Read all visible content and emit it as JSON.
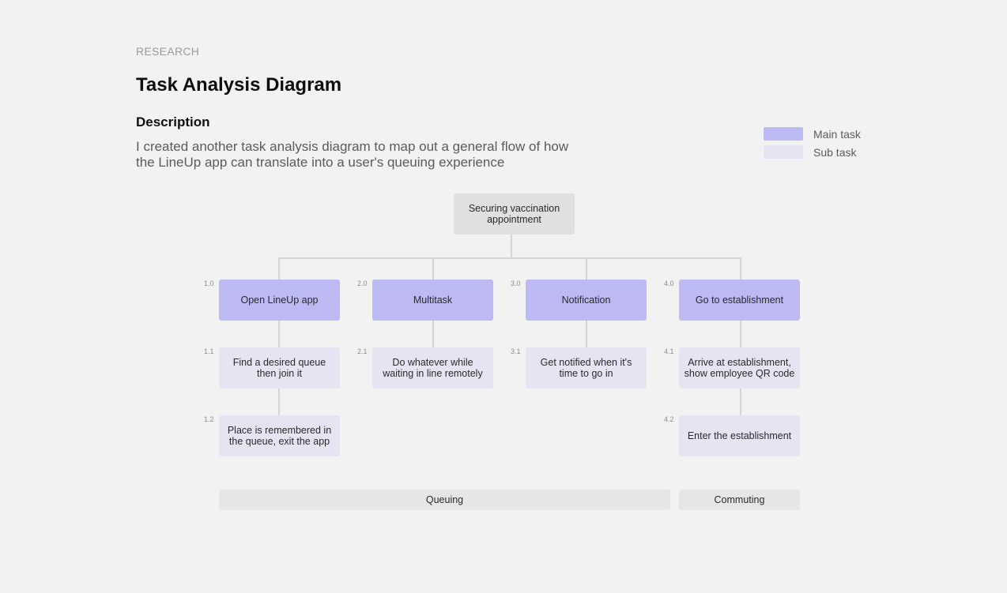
{
  "header": {
    "eyebrow": "RESEARCH",
    "title": "Task Analysis Diagram",
    "description_heading": "Description",
    "description_text": "I created another task analysis diagram to map out a general flow of how the LineUp app can translate into a user's queuing experience"
  },
  "legend": {
    "items": [
      {
        "label": "Main task",
        "color": "#bdb9f2"
      },
      {
        "label": "Sub task",
        "color": "#e6e4f3"
      }
    ]
  },
  "colors": {
    "background": "#f2f2f2",
    "root": "#e0e0e0",
    "main": "#bdb9f2",
    "sub": "#e6e4f3",
    "connector": "#d5d5d5",
    "phase": "#e6e6e6"
  },
  "diagram": {
    "root": {
      "label": "Securing vaccination appointment"
    },
    "columns": [
      {
        "number": "1.0",
        "label": "Open LineUp app",
        "subtasks": [
          {
            "number": "1.1",
            "label": "Find a desired queue then join it"
          },
          {
            "number": "1.2",
            "label": "Place is remembered in the queue, exit the app"
          }
        ]
      },
      {
        "number": "2.0",
        "label": "Multitask",
        "subtasks": [
          {
            "number": "2.1",
            "label": "Do whatever while waiting in line remotely"
          }
        ]
      },
      {
        "number": "3.0",
        "label": "Notification",
        "subtasks": [
          {
            "number": "3.1",
            "label": "Get notified when it's time to go in"
          }
        ]
      },
      {
        "number": "4.0",
        "label": "Go to establishment",
        "subtasks": [
          {
            "number": "4.1",
            "label": "Arrive at establishment, show employee QR code"
          },
          {
            "number": "4.2",
            "label": "Enter the establishment"
          }
        ]
      }
    ],
    "phases": [
      {
        "label": "Queuing"
      },
      {
        "label": "Commuting"
      }
    ]
  }
}
